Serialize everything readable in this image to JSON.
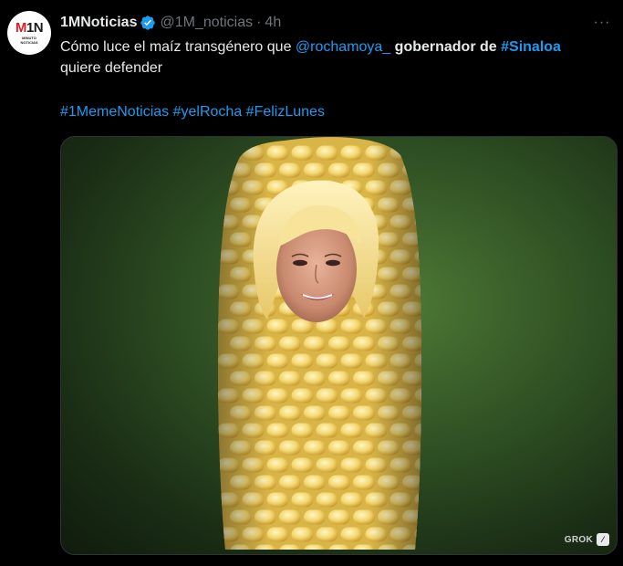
{
  "tweet": {
    "avatar": {
      "logo_mark_left": "M",
      "logo_mark_mid": "1",
      "logo_mark_right": "N",
      "logo_sub_line1": "MINUTO",
      "logo_sub_line2": "NOTICIAS"
    },
    "display_name": "1MNoticias",
    "handle": "@1M_noticias",
    "separator": "·",
    "time": "4h",
    "more_label": "···",
    "text": {
      "part1": "Cómo luce el maíz transgénero que ",
      "mention": "@rochamoya_",
      "part2": " gobernador de ",
      "hashtag_inline": "#Sinaloa",
      "part3": "quiere defender"
    },
    "hashtags": [
      "#1MemeNoticias",
      "#yelRocha",
      "#FelizLunes"
    ],
    "media": {
      "alt": "Corn cob with a smiling blonde woman's face",
      "badge_label": "GROK",
      "badge_icon": "grok-icon"
    },
    "colors": {
      "background": "#000000",
      "text": "#e7e9ea",
      "muted": "#71767b",
      "link": "#1d9bf0",
      "verified": "#1d9bf0"
    }
  }
}
